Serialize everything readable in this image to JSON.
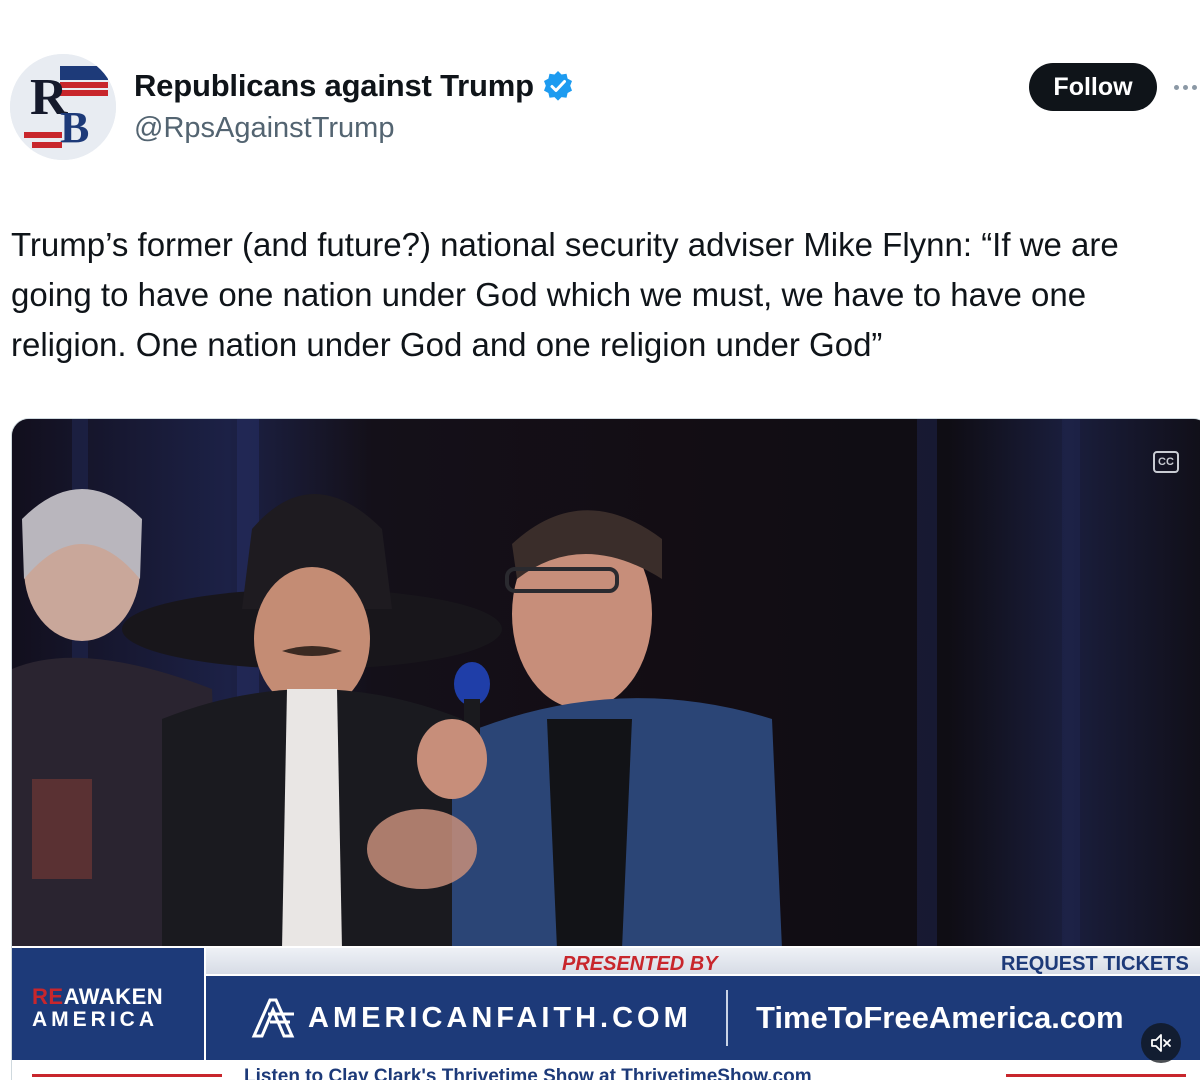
{
  "author": {
    "display_name": "Republicans against Trump",
    "handle": "@RpsAgainstTrump",
    "verified": true,
    "avatar_icon": "rb-logo-icon",
    "avatar_text": "RB"
  },
  "actions": {
    "follow_label": "Follow",
    "more_icon": "more-icon"
  },
  "tweet": {
    "text": "Trump’s former (and future?) national security adviser Mike Flynn: “If we are going to have one nation under God which we must, we have to have one religion. One nation under God and one religion under God”"
  },
  "video": {
    "captions_icon": "captions-icon",
    "mute_icon": "mute-icon",
    "overlay": {
      "brand_line1_prefix": "RE",
      "brand_line1": "AWAKEN",
      "brand_line2": "AMERICA",
      "presented_by": "PRESENTED BY",
      "request_tickets": "REQUEST TICKETS AT:",
      "site1": "AMERICANFAITH.COM",
      "site2": "TimeToFreeAmerica.com",
      "ticker": "Listen to Clay Clark's Thrivetime Show at ThrivetimeShow.com"
    }
  },
  "colors": {
    "navy": "#1d3a79",
    "red": "#c8262c",
    "verified_blue": "#1d9bf0",
    "text_secondary": "#536471"
  }
}
